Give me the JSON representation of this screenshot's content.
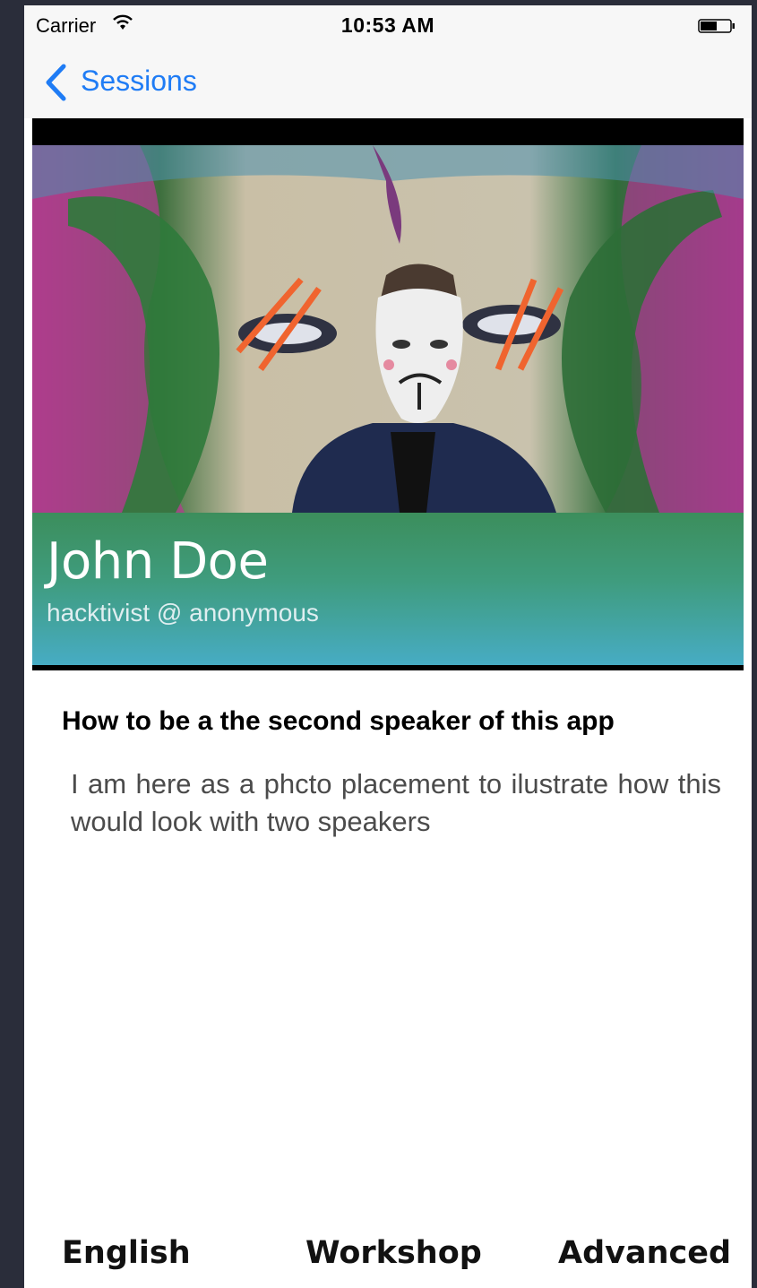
{
  "status_bar": {
    "carrier": "Carrier",
    "time": "10:53 AM"
  },
  "nav": {
    "back_label": "Sessions"
  },
  "speaker": {
    "name": "John Doe",
    "role": "hacktivist @ anonymous"
  },
  "session": {
    "title": "How to be a the second speaker of this app",
    "description": "I am here as a phcto placement to ilustrate how this would look with two speakers"
  },
  "tags": {
    "language": "English",
    "format": "Workshop",
    "level": "Advanced"
  },
  "colors": {
    "accent": "#1f7cf5",
    "panel_top": "#3c8e5c",
    "panel_bottom": "#47acc4",
    "background": "#2a2d3a"
  },
  "icons": [
    "wifi-icon",
    "battery-icon",
    "back-chevron-icon"
  ]
}
